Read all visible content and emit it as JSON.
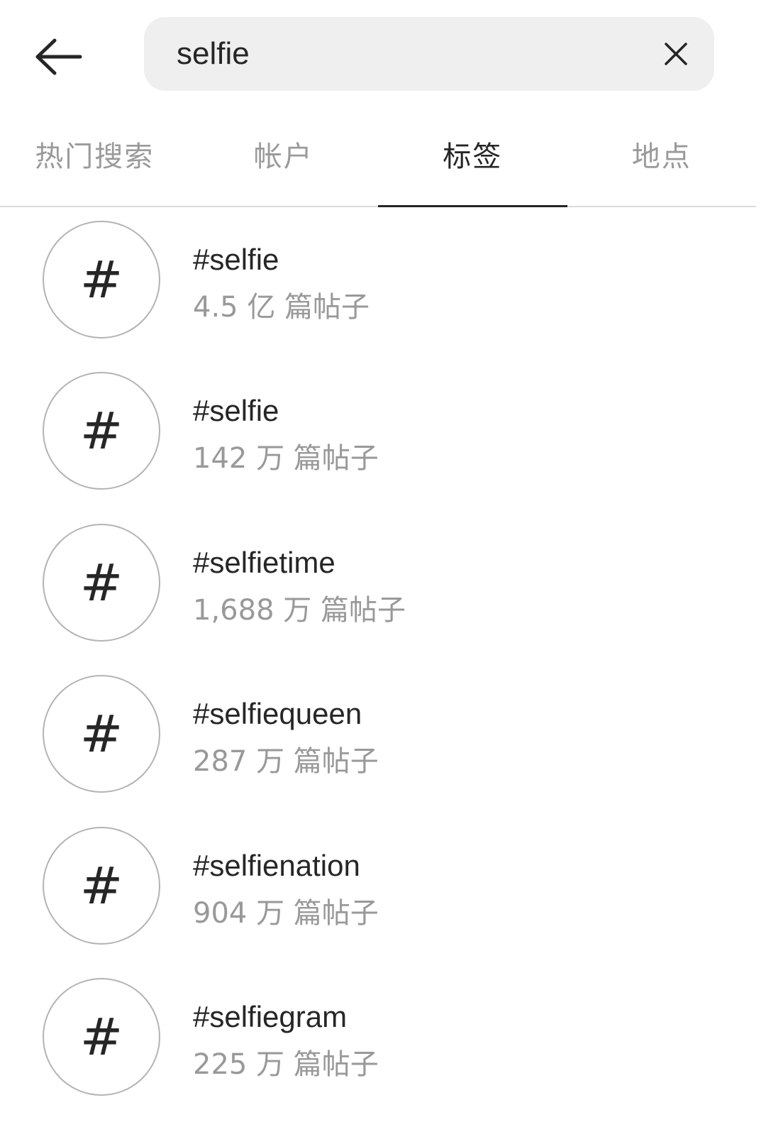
{
  "header": {
    "back_icon": "arrow-left-icon",
    "search_value": "selfie",
    "clear_icon": "close-icon"
  },
  "tabs": [
    {
      "label": "热门搜索",
      "active": false
    },
    {
      "label": "帐户",
      "active": false
    },
    {
      "label": "标签",
      "active": true
    },
    {
      "label": "地点",
      "active": false
    }
  ],
  "results": [
    {
      "icon": "#",
      "tag": "#selfie",
      "count": "4.5 亿 篇帖子"
    },
    {
      "icon": "#",
      "tag": "#selfie",
      "count": "142 万 篇帖子"
    },
    {
      "icon": "#",
      "tag": "#selfietime",
      "count": "1,688 万 篇帖子"
    },
    {
      "icon": "#",
      "tag": "#selfiequeen",
      "count": "287 万 篇帖子"
    },
    {
      "icon": "#",
      "tag": "#selfienation",
      "count": "904 万 篇帖子"
    },
    {
      "icon": "#",
      "tag": "#selfiegram",
      "count": "225 万 篇帖子"
    }
  ]
}
